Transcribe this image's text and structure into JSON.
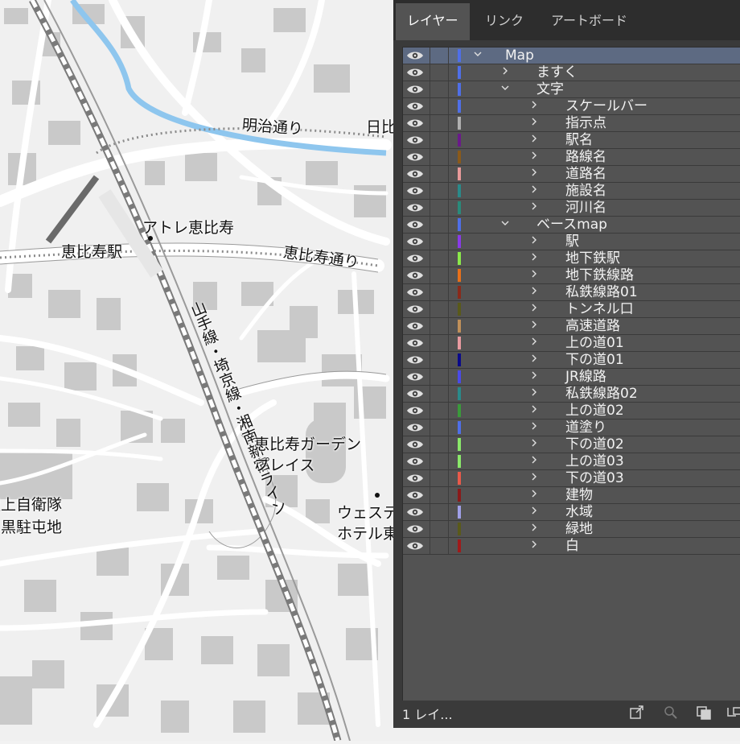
{
  "map": {
    "labels": {
      "meiji": "明治通り",
      "hibi": "日比",
      "atre": "アトレ恵比寿",
      "station": "恵比寿駅",
      "ebisu_dori": "恵比寿通り",
      "jr_line": "山手線・埼京線・湘南新宿ライン",
      "garden_1": "恵比寿ガーデン",
      "garden_2": "プレイス",
      "jgsdf_1": "陸上自衛隊",
      "jgsdf_2": "目黒駐屯地",
      "westin_1": "ウェスティ",
      "westin_2": "ホテル東"
    }
  },
  "panel": {
    "tabs": [
      {
        "label": "レイヤー",
        "active": true
      },
      {
        "label": "リンク",
        "active": false
      },
      {
        "label": "アートボード",
        "active": false
      }
    ],
    "layers": [
      {
        "name": "Map",
        "color": "#4f6fe8",
        "level": 0,
        "expanded": true,
        "selected": true
      },
      {
        "name": "ますく",
        "color": "#4f6fe8",
        "level": 1,
        "expanded": false
      },
      {
        "name": "文字",
        "color": "#4f6fe8",
        "level": 1,
        "expanded": true
      },
      {
        "name": "スケールバー",
        "color": "#4f6fe8",
        "level": 2,
        "expanded": false
      },
      {
        "name": "指示点",
        "color": "#b0b0b0",
        "level": 2,
        "expanded": false
      },
      {
        "name": "駅名",
        "color": "#6a1a8a",
        "level": 2,
        "expanded": false
      },
      {
        "name": "路線名",
        "color": "#8a5a1a",
        "level": 2,
        "expanded": false
      },
      {
        "name": "道路名",
        "color": "#e89a9a",
        "level": 2,
        "expanded": false
      },
      {
        "name": "施設名",
        "color": "#2a8a8a",
        "level": 2,
        "expanded": false
      },
      {
        "name": "河川名",
        "color": "#2a8a7a",
        "level": 2,
        "expanded": false
      },
      {
        "name": "ベースmap",
        "color": "#4f6fe8",
        "level": 1,
        "expanded": true
      },
      {
        "name": "駅",
        "color": "#8a3ae8",
        "level": 2,
        "expanded": false
      },
      {
        "name": "地下鉄駅",
        "color": "#8ae84a",
        "level": 2,
        "expanded": false
      },
      {
        "name": "地下鉄線路",
        "color": "#e8701a",
        "level": 2,
        "expanded": false
      },
      {
        "name": "私鉄線路01",
        "color": "#8a2a1a",
        "level": 2,
        "expanded": false
      },
      {
        "name": "トンネル口",
        "color": "#5a5a1a",
        "level": 2,
        "expanded": false
      },
      {
        "name": "高速道路",
        "color": "#c0905a",
        "level": 2,
        "expanded": false
      },
      {
        "name": "上の道01",
        "color": "#e89aa0",
        "level": 2,
        "expanded": false
      },
      {
        "name": "下の道01",
        "color": "#0a0a8a",
        "level": 2,
        "expanded": false
      },
      {
        "name": "JR線路",
        "color": "#4a4ae8",
        "level": 2,
        "expanded": false
      },
      {
        "name": "私鉄線路02",
        "color": "#2a8a8a",
        "level": 2,
        "expanded": false
      },
      {
        "name": "上の道02",
        "color": "#3a9a3a",
        "level": 2,
        "expanded": false
      },
      {
        "name": "道塗り",
        "color": "#4f6fe8",
        "level": 2,
        "expanded": false
      },
      {
        "name": "下の道02",
        "color": "#8ae86a",
        "level": 2,
        "expanded": false
      },
      {
        "name": "上の道03",
        "color": "#8ae86a",
        "level": 2,
        "expanded": false
      },
      {
        "name": "下の道03",
        "color": "#e85a4a",
        "level": 2,
        "expanded": false
      },
      {
        "name": "建物",
        "color": "#8a1a1a",
        "level": 2,
        "expanded": false
      },
      {
        "name": "水域",
        "color": "#a0a0e8",
        "level": 2,
        "expanded": false
      },
      {
        "name": "緑地",
        "color": "#5a5a1a",
        "level": 2,
        "expanded": false
      },
      {
        "name": "白",
        "color": "#a01a1a",
        "level": 2,
        "expanded": false
      }
    ],
    "footer": {
      "count": "1 レイ...",
      "icons": [
        "export-icon",
        "search-icon",
        "clipping-mask-icon",
        "new-sublayer-icon"
      ]
    }
  }
}
